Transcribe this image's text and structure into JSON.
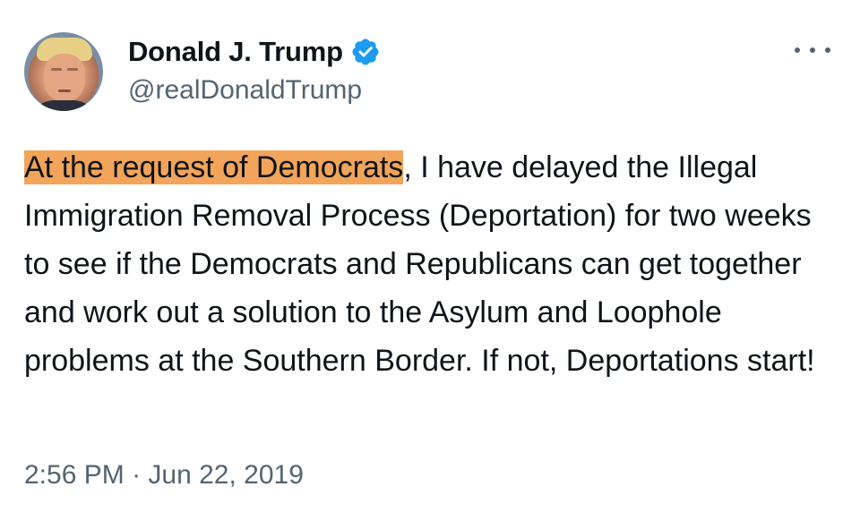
{
  "author": {
    "name": "Donald J. Trump",
    "handle": "@realDonaldTrump",
    "verified_icon": "verified-badge-icon",
    "verified_color": "#1d9bf0"
  },
  "menu": {
    "icon": "more-options-icon"
  },
  "tweet": {
    "highlighted_text": "At the request of Democrats",
    "text_after_highlight": ", I have delayed the Illegal Immigration Removal Process (Deportation) for two weeks to see if the Democrats and Republicans can get together and work out a solution to the Asylum and Loophole problems at the Southern Border. If not, Deportations start!",
    "highlight_color": "#f2a45a",
    "time": "2:56 PM",
    "separator": "·",
    "date": "Jun 22, 2019"
  }
}
